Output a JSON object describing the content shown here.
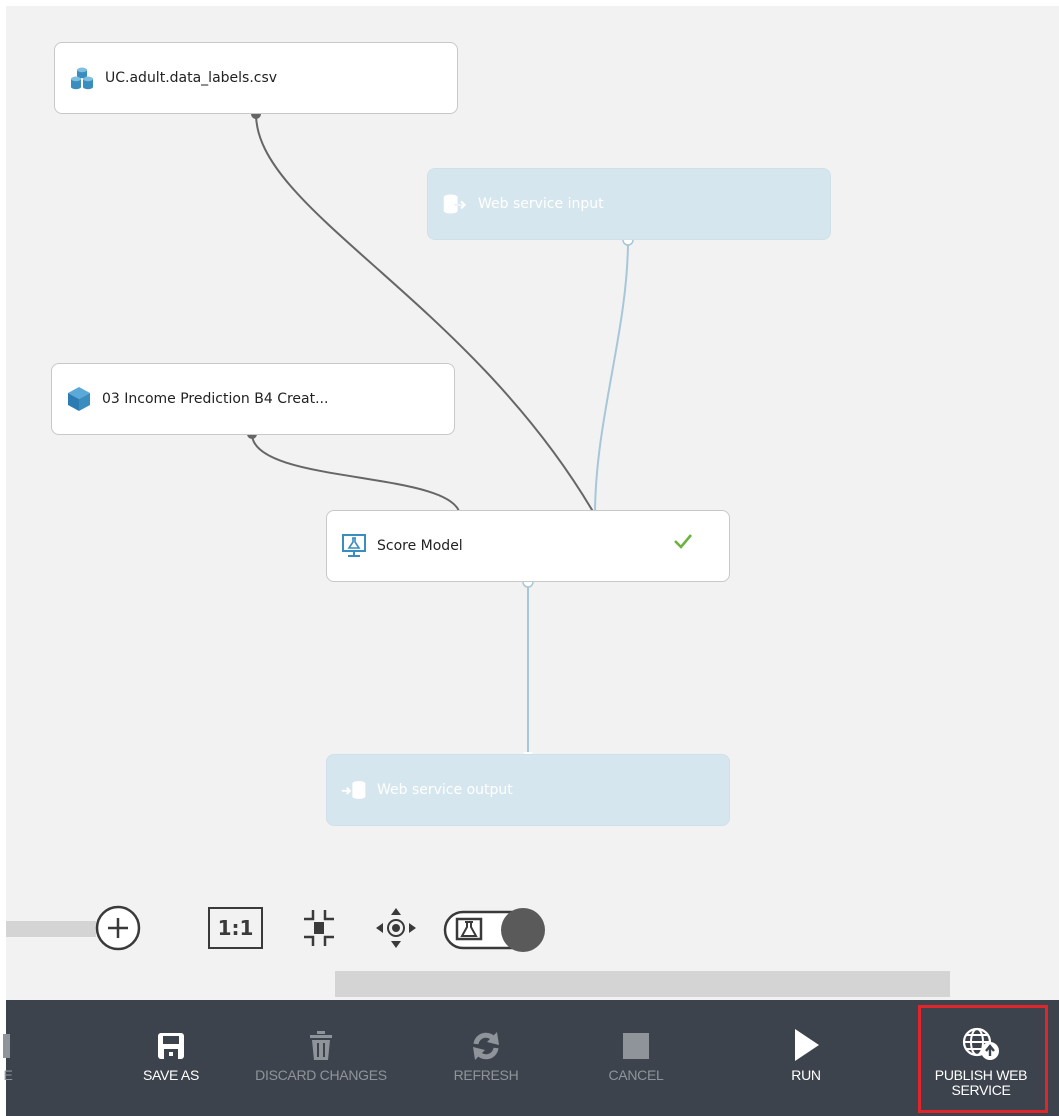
{
  "canvas": {
    "nodes": {
      "dataset": {
        "label": "UC.adult.data_labels.csv",
        "icon": "dataset-icon"
      },
      "web_input": {
        "label": "Web service input",
        "icon": "web-service-input-icon"
      },
      "trained_model": {
        "label": "03 Income Prediction B4 Creat...",
        "icon": "trained-model-icon"
      },
      "score_model": {
        "label": "Score Model",
        "icon": "score-model-icon",
        "status": "check-icon"
      },
      "web_output": {
        "label": "Web service output",
        "icon": "web-service-output-icon"
      }
    },
    "zoom_actual_size": "1:1"
  },
  "command_bar": {
    "partial_label": "E",
    "save_as": "SAVE AS",
    "discard_changes": "DISCARD CHANGES",
    "refresh": "REFRESH",
    "cancel": "CANCEL",
    "run": "RUN",
    "publish_line1": "PUBLISH WEB",
    "publish_line2": "SERVICE"
  },
  "colors": {
    "canvas_bg": "#f2f2f2",
    "command_bar_bg": "#3d434d",
    "web_service_node": "#d6e6ee",
    "connector_gray": "#666666",
    "connector_blue": "#a7c7d8",
    "success_green": "#6cb33f",
    "highlight_red": "#e0262a",
    "icon_blue": "#3a8dbf"
  }
}
